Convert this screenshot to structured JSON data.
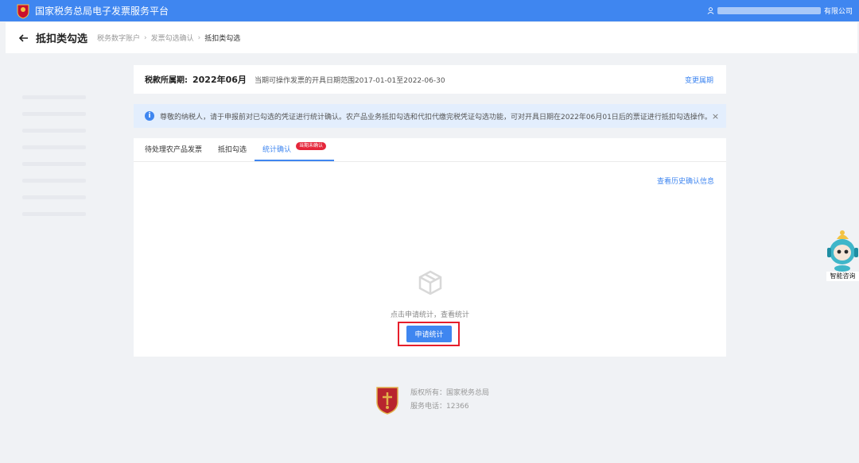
{
  "topbar": {
    "title": "国家税务总局电子发票服务平台",
    "user_suffix": "有限公司",
    "user_icon": "user-icon",
    "color": "#3f86f0"
  },
  "header": {
    "page_title": "抵扣类勾选",
    "breadcrumb": [
      "税务数字账户",
      "发票勾选确认",
      "抵扣类勾选"
    ]
  },
  "period": {
    "label": "税款所属期:",
    "value": "2022年06月",
    "range_text": "当期可操作发票的开具日期范围2017-01-01至2022-06-30",
    "change_link": "变更属期"
  },
  "notice": {
    "text": "尊敬的纳税人，请于申报前对已勾选的凭证进行统计确认。农产品业务抵扣勾选和代扣代缴完税凭证勾选功能，可对开具日期在2022年06月01日后的票证进行抵扣勾选操作。",
    "close": "×"
  },
  "tabs": [
    {
      "label": "待处理农产品发票",
      "active": false
    },
    {
      "label": "抵扣勾选",
      "active": false
    },
    {
      "label": "统计确认",
      "active": true,
      "badge": "当期未确认"
    }
  ],
  "panel": {
    "history_link": "查看历史确认信息",
    "empty_text": "点击申请统计，查看统计",
    "apply_button": "申请统计"
  },
  "footer": {
    "copyright": "版权所有：国家税务总局",
    "phone": "服务电话：12366"
  },
  "assistant": {
    "label": "智能咨询"
  }
}
